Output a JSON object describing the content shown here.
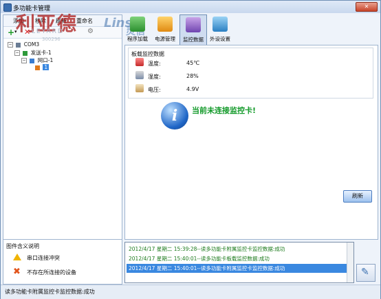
{
  "window": {
    "title": "多功能卡管理"
  },
  "watermark": {
    "text": "利亚德",
    "brand": "Linsn",
    "brand_cn": "灵信",
    "logo_ghost": "LEYARD",
    "serial_ghost": "300296"
  },
  "left_menu": [
    "添加",
    "移除",
    "刷新",
    "重命名"
  ],
  "tree": {
    "root": "COM3",
    "card": "发送卡-1",
    "port": "网口-1",
    "leaf": "1"
  },
  "legend": {
    "title": "图件含义说明",
    "items": [
      "串口连接冲突",
      "不存在所连接的设备"
    ]
  },
  "toolbar": {
    "items": [
      {
        "label": "程序加载",
        "icon": "program-load-icon"
      },
      {
        "label": "电源管理",
        "icon": "power-manage-icon"
      },
      {
        "label": "监控数据",
        "icon": "monitor-data-icon",
        "selected": true
      },
      {
        "label": "外设设置",
        "icon": "peripheral-settings-icon"
      }
    ]
  },
  "monitor": {
    "group_title": "板载监控数据",
    "temperature": {
      "label": "温度:",
      "value": "45℃"
    },
    "humidity": {
      "label": "湿度:",
      "value": "28%"
    },
    "voltage": {
      "label": "电压:",
      "value": "4.9V"
    }
  },
  "message": "当前未连接监控卡!",
  "refresh_button": "刷新",
  "log": [
    "2012/4/17 星期二 15:39:28--读多功能卡附属监控卡监控数据:成功",
    "2012/4/17 星期二 15:40:01--读多功能卡板载监控数据:成功",
    "2012/4/17 星期二 15:40:01--读多功能卡附属监控卡监控数据:成功"
  ],
  "status": "读多功能卡附属监控卡监控数据:成功",
  "colors": {
    "accent": "#3a88e0",
    "message_green": "#139a2a",
    "log_green": "#1b7a1b"
  }
}
